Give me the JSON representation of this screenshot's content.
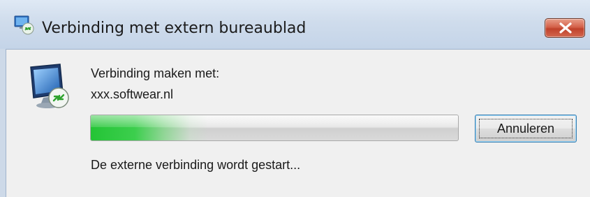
{
  "window": {
    "title": "Verbinding met extern bureaublad",
    "icon": "remote-desktop-icon",
    "close_icon": "close-icon"
  },
  "dialog": {
    "connecting_label": "Verbinding maken met:",
    "host": "xxx.softwear.nl",
    "status_text": "De externe verbinding wordt gestart...",
    "cancel_label": "Annuleren",
    "progress_state": "indeterminate",
    "icon": "remote-desktop-monitor-icon"
  },
  "colors": {
    "progress_green": "#24c436",
    "close_button_red": "#c0422b",
    "button_focus_blue": "#3c7fb1"
  }
}
